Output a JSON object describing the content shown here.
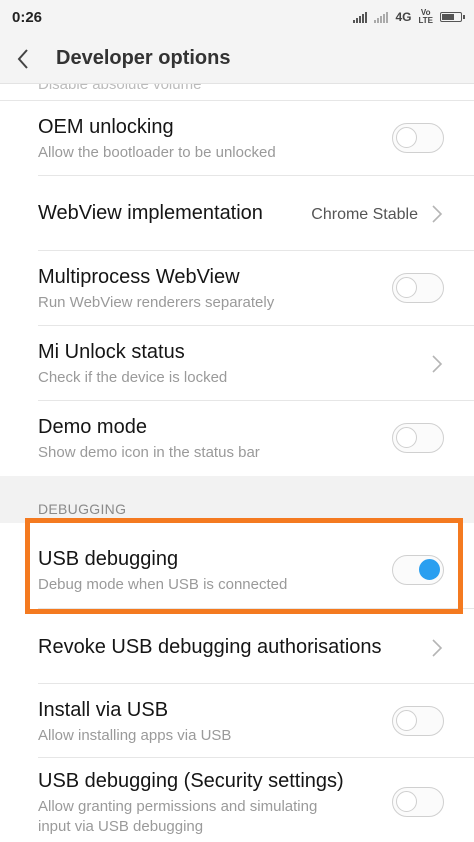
{
  "status_bar": {
    "time": "0:26",
    "network": "4G",
    "volte_top": "Vo",
    "volte_bottom": "LTE"
  },
  "app_bar": {
    "title": "Developer options"
  },
  "cut_row": {
    "text": "Disable absolute volume"
  },
  "rows": [
    {
      "title": "OEM unlocking",
      "subtitle": "Allow the bootloader to be unlocked",
      "toggle": false
    },
    {
      "title": "WebView implementation",
      "value": "Chrome Stable"
    },
    {
      "title": "Multiprocess WebView",
      "subtitle": "Run WebView renderers separately",
      "toggle": false
    },
    {
      "title": "Mi Unlock status",
      "subtitle": "Check if the device is locked"
    },
    {
      "title": "Demo mode",
      "subtitle": "Show demo icon in the status bar",
      "toggle": false
    }
  ],
  "debugging": {
    "header": "DEBUGGING",
    "rows": [
      {
        "title": "USB debugging",
        "subtitle": "Debug mode when USB is connected",
        "toggle": true
      },
      {
        "title": "Revoke USB debugging authorisations"
      },
      {
        "title": "Install via USB",
        "subtitle": "Allow installing apps via USB",
        "toggle": false
      },
      {
        "title": "USB debugging (Security settings)",
        "subtitle_line1": "Allow granting permissions and simulating",
        "subtitle_line2": "input via USB debugging",
        "toggle": false
      }
    ]
  },
  "colors": {
    "accent": "#2a9ff0",
    "highlight": "#f47a20"
  }
}
